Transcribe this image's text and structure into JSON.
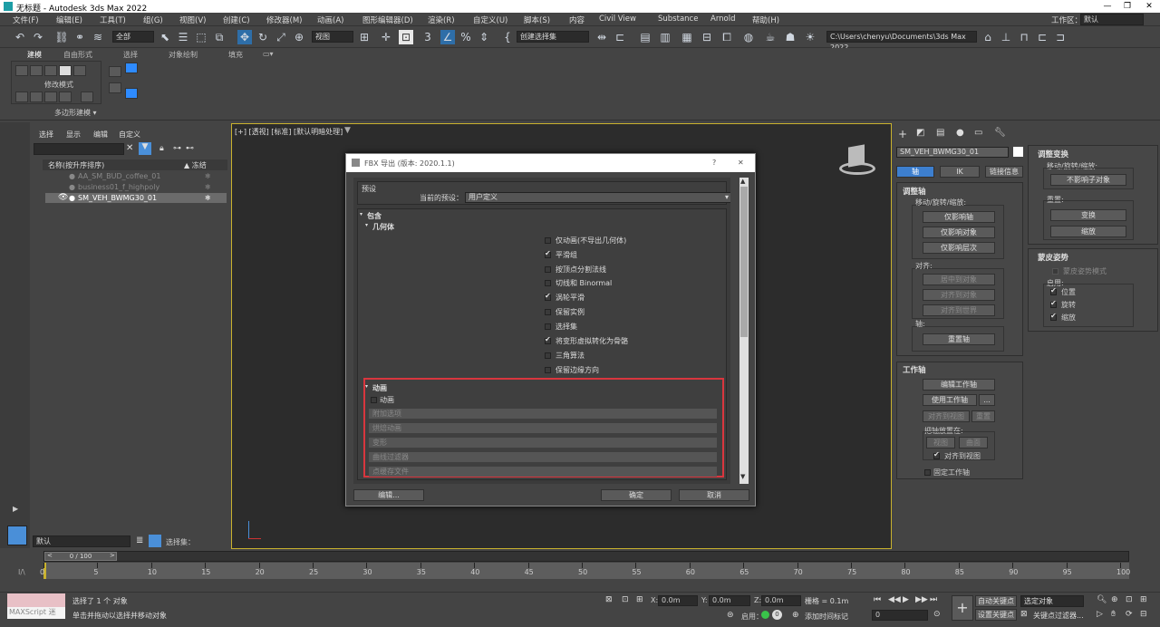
{
  "window": {
    "title": "无标题 - Autodesk 3ds Max 2022"
  },
  "menu": [
    "文件(F)",
    "编辑(E)",
    "工具(T)",
    "组(G)",
    "视图(V)",
    "创建(C)",
    "修改器(M)",
    "动画(A)",
    "图形编辑器(D)",
    "渲染(R)",
    "自定义(U)",
    "脚本(S)",
    "内容",
    "Civil View",
    "Substance",
    "Arnold",
    "帮助(H)"
  ],
  "workspace": {
    "label": "工作区：",
    "value": "默认"
  },
  "toolbar": {
    "filter": "全部",
    "view": "视图",
    "selset": "创建选择集",
    "path": "C:\\Users\\chenyu\\Documents\\3ds Max 2022"
  },
  "ribbon": {
    "tabs": [
      "建模",
      "自由形式",
      "选择",
      "对象绘制",
      "填充"
    ],
    "group1": "修改模式",
    "group2": "多边形建模 ▾"
  },
  "scene": {
    "tabs": [
      "选择",
      "显示",
      "编辑",
      "自定义"
    ],
    "col_name": "名称(按升序排序)",
    "col_freeze": "▲ 冻结",
    "rows": [
      "AA_SM_BUD_coffee_01",
      "business01_f_highpoly",
      "SM_VEH_BWMG30_01"
    ],
    "layer": "默认",
    "selset_label": "选择集："
  },
  "viewport": {
    "label": "[+] [透视] [标准] [默认明暗处理]"
  },
  "dialog": {
    "title": "FBX 导出 (版本: 2020.1.1)",
    "help": "?",
    "close": "✕",
    "preset_section": "预设",
    "preset_label": "当前的预设：",
    "preset_value": "用户定义",
    "include": "包含",
    "geometry": "几何体",
    "geo_options": [
      {
        "label": "仅动画(不导出几何体)",
        "checked": false
      },
      {
        "label": "平滑组",
        "checked": true
      },
      {
        "label": "按顶点分割法线",
        "checked": false
      },
      {
        "label": "切线和 Binormal",
        "checked": false
      },
      {
        "label": "涡轮平滑",
        "checked": true
      },
      {
        "label": "保留实例",
        "checked": false
      },
      {
        "label": "选择集",
        "checked": false
      },
      {
        "label": "将变形虚拟转化为骨骼",
        "checked": true
      },
      {
        "label": "三角算法",
        "checked": false
      },
      {
        "label": "保留边缘方向",
        "checked": false
      }
    ],
    "animation": "动画",
    "anim_check": "动画",
    "anim_subs": [
      "附加选项",
      "烘焙动画",
      "变形",
      "曲线过滤器",
      "点缓存文件"
    ],
    "edit_btn": "编辑...",
    "ok_btn": "确定",
    "cancel_btn": "取消"
  },
  "cmd": {
    "object_name": "SM_VEH_BWMG30_01",
    "tabs": [
      "轴",
      "IK",
      "链接信息"
    ],
    "adjust_pivot": "调整轴",
    "move_rot_scale": "移动/旋转/缩放:",
    "affect_pivot": "仅影响轴",
    "affect_object": "仅影响对象",
    "affect_hier": "仅影响层次",
    "align": "对齐:",
    "center": "居中到对象",
    "align_obj": "对齐到对象",
    "align_world": "对齐到世界",
    "pivot": "轴:",
    "reset_pivot": "重置轴",
    "working_pivot": "工作轴",
    "edit_wp": "编辑工作轴",
    "use_wp": "使用工作轴",
    "ellipsis": "...",
    "align_view": "对齐到视图",
    "reset": "重置",
    "placement": "把轴放置在:",
    "view": "视图",
    "surface": "曲面",
    "align_to_view": "对齐到视图",
    "lock_wp": "固定工作轴"
  },
  "rpanel": {
    "adjust_transform": "调整变换",
    "mrs": "移动/旋转/缩放:",
    "dont_affect": "不影响子对象",
    "reset": "重置:",
    "transform": "变换",
    "scale": "缩放",
    "skin_pose": "蒙皮姿势",
    "skin_mode": "蒙皮姿势模式",
    "enable": "启用:",
    "pos": "位置",
    "rot": "旋转",
    "scl": "缩放"
  },
  "timeline": {
    "frame": "0 / 100",
    "ticks": [
      "0",
      "5",
      "10",
      "15",
      "20",
      "25",
      "30",
      "35",
      "40",
      "45",
      "50",
      "55",
      "60",
      "65",
      "70",
      "75",
      "80",
      "85",
      "90",
      "95",
      "100"
    ]
  },
  "status": {
    "script": "MAXScript 迷",
    "selected": "选择了 1 个 对象",
    "hint": "单击并拖动以选择并移动对象",
    "x": "0.0m",
    "y": "0.0m",
    "z": "0.0m",
    "grid": "栅格 = 0.1m",
    "enable": "启用：",
    "add_tag": "添加时间标记",
    "auto_key": "自动关键点",
    "set_key": "设置关键点",
    "sel_obj": "选定对象",
    "key_filter": "关键点过滤器...",
    "frame_spin": "0"
  },
  "colors": {
    "accent": "#2e8bff",
    "frame_yellow": "#c9b22e",
    "highlight": "#d9363e"
  }
}
